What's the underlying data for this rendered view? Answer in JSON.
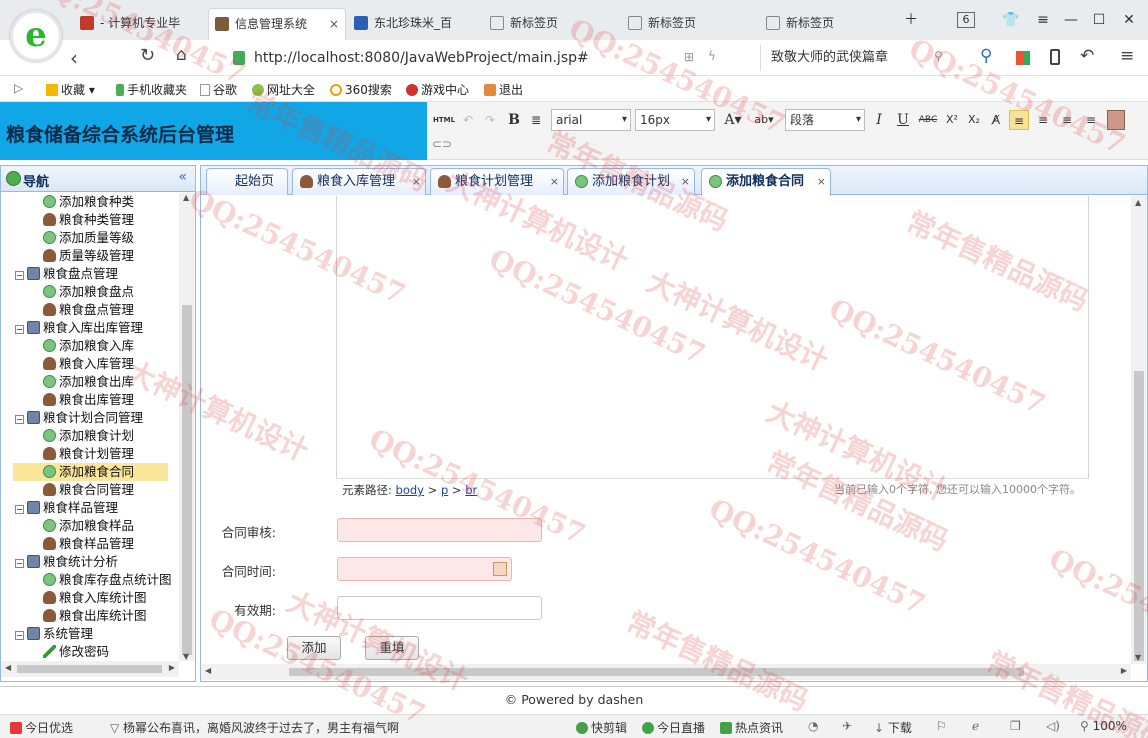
{
  "browser": {
    "tabs": [
      {
        "label": "- 计算机专业毕",
        "color": "#c0392b"
      },
      {
        "label": "信息管理系统",
        "color": "#7a5b3a",
        "active": true
      },
      {
        "label": "东北珍珠米_百",
        "color": "#2c5fb3"
      },
      {
        "label": "新标签页",
        "color": "#8a8a8a"
      },
      {
        "label": "新标签页",
        "color": "#8a8a8a"
      },
      {
        "label": "新标签页",
        "color": "#8a8a8a"
      }
    ],
    "tab_count": "6",
    "url": "http://localhost:8080/JavaWebProject/main.jsp#",
    "search_text": "致敬大师的武侠篇章",
    "bookmarks": [
      "收藏",
      "手机收藏夹",
      "谷歌",
      "网址大全",
      "360搜索",
      "游戏中心",
      "退出"
    ]
  },
  "app": {
    "title": "粮食储备综合系统后台管理"
  },
  "editor_toolbar": {
    "html_label": "HTML",
    "bold": "B",
    "font_family": "arial",
    "font_size": "16px",
    "paragraph": "段落",
    "italic": "I",
    "underline": "U",
    "strike": "ABC",
    "sup": "X²",
    "sub": "X₂"
  },
  "nav": {
    "header": "导航",
    "items": [
      {
        "label": "添加粮食种类",
        "level": 2,
        "icon": "add"
      },
      {
        "label": "粮食种类管理",
        "level": 2,
        "icon": "user"
      },
      {
        "label": "添加质量等级",
        "level": 2,
        "icon": "add"
      },
      {
        "label": "质量等级管理",
        "level": 2,
        "icon": "user"
      },
      {
        "label": "粮食盘点管理",
        "level": 1,
        "icon": "folder"
      },
      {
        "label": "添加粮食盘点",
        "level": 2,
        "icon": "add"
      },
      {
        "label": "粮食盘点管理",
        "level": 2,
        "icon": "user"
      },
      {
        "label": "粮食入库出库管理",
        "level": 1,
        "icon": "folder"
      },
      {
        "label": "添加粮食入库",
        "level": 2,
        "icon": "add"
      },
      {
        "label": "粮食入库管理",
        "level": 2,
        "icon": "user"
      },
      {
        "label": "添加粮食出库",
        "level": 2,
        "icon": "add"
      },
      {
        "label": "粮食出库管理",
        "level": 2,
        "icon": "user"
      },
      {
        "label": "粮食计划合同管理",
        "level": 1,
        "icon": "folder"
      },
      {
        "label": "添加粮食计划",
        "level": 2,
        "icon": "add"
      },
      {
        "label": "粮食计划管理",
        "level": 2,
        "icon": "user"
      },
      {
        "label": "添加粮食合同",
        "level": 2,
        "icon": "add",
        "selected": true
      },
      {
        "label": "粮食合同管理",
        "level": 2,
        "icon": "user"
      },
      {
        "label": "粮食样品管理",
        "level": 1,
        "icon": "folder"
      },
      {
        "label": "添加粮食样品",
        "level": 2,
        "icon": "add"
      },
      {
        "label": "粮食样品管理",
        "level": 2,
        "icon": "user"
      },
      {
        "label": "粮食统计分析",
        "level": 1,
        "icon": "folder"
      },
      {
        "label": "粮食库存盘点统计图",
        "level": 2,
        "icon": "add"
      },
      {
        "label": "粮食入库统计图",
        "level": 2,
        "icon": "user"
      },
      {
        "label": "粮食出库统计图",
        "level": 2,
        "icon": "user"
      },
      {
        "label": "系统管理",
        "level": 1,
        "icon": "folder"
      },
      {
        "label": "修改密码",
        "level": 2,
        "icon": "pen"
      }
    ]
  },
  "content_tabs": [
    {
      "label": "起始页",
      "icon": "none"
    },
    {
      "label": "粮食入库管理",
      "icon": "user"
    },
    {
      "label": "粮食计划管理",
      "icon": "user"
    },
    {
      "label": "添加粮食计划",
      "icon": "add"
    },
    {
      "label": "添加粮食合同",
      "icon": "add",
      "active": true
    }
  ],
  "editor": {
    "path_label": "元素路径:",
    "path": [
      "body",
      "p",
      "br"
    ],
    "count_text": "当前已输入0个字符, 您还可以输入10000个字符。"
  },
  "form": {
    "review_label": "合同审核:",
    "time_label": "合同时间:",
    "valid_label": "有效期:",
    "add_button": "添加",
    "reset_button": "重填"
  },
  "footer": "© Powered by dashen",
  "statusbar": {
    "items": [
      "今日优选",
      "杨幂公布喜讯，离婚风波终于过去了，男主有福气啊",
      "快剪辑",
      "今日直播",
      "热点资讯",
      "下载",
      "100%"
    ]
  },
  "watermark": {
    "texts": [
      "QQ:254540457",
      "大神计算机设计",
      "常年售精品源码"
    ]
  },
  "colors": {
    "header_blue": "#11a7e6",
    "panel_border": "#95b8e7",
    "selected_item": "#fbe69a",
    "required_bg": "#fde8e8"
  }
}
